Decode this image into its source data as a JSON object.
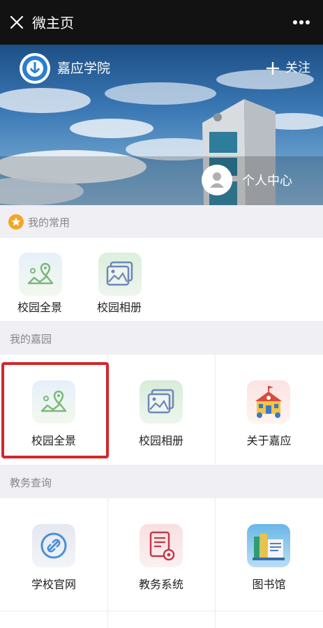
{
  "topbar": {
    "title": "微主页",
    "close_icon": "close-icon",
    "more_icon": "more-icon"
  },
  "banner": {
    "school_name": "嘉应学院",
    "follow_label": "关注",
    "personal_center_label": "个人中心"
  },
  "sections": {
    "frequent": {
      "title": "我的常用",
      "items": [
        {
          "label": "校园全景",
          "icon": "map-pin-icon"
        },
        {
          "label": "校园相册",
          "icon": "photo-album-icon"
        }
      ]
    },
    "my_campus": {
      "title": "我的嘉园",
      "items": [
        {
          "label": "校园全景",
          "icon": "map-pin-icon"
        },
        {
          "label": "校园相册",
          "icon": "photo-album-icon"
        },
        {
          "label": "关于嘉应",
          "icon": "school-building-icon"
        }
      ]
    },
    "academic": {
      "title": "教务查询",
      "items": [
        {
          "label": "学校官网",
          "icon": "link-icon"
        },
        {
          "label": "教务系统",
          "icon": "document-settings-icon"
        },
        {
          "label": "图书馆",
          "icon": "books-icon"
        }
      ]
    }
  },
  "colors": {
    "topbar": "#121212",
    "highlight": "#d4262a",
    "star": "#f5a623"
  }
}
